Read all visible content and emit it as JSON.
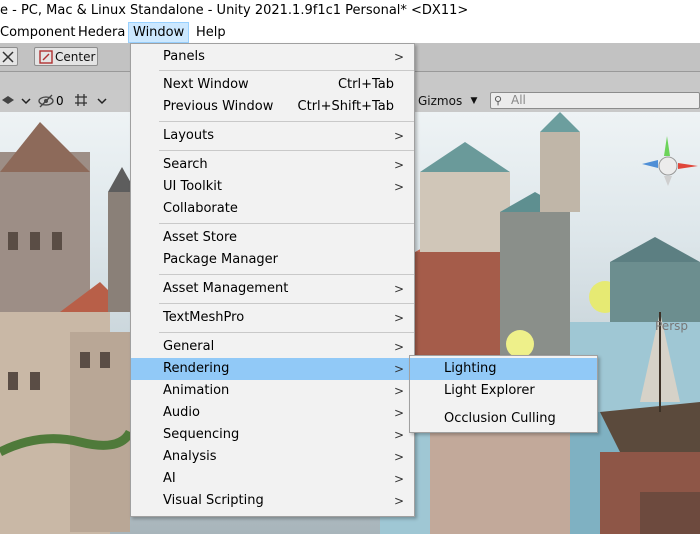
{
  "window": {
    "title": "e - PC, Mac & Linux Standalone - Unity 2021.1.9f1c1 Personal* <DX11>"
  },
  "menubar": {
    "items": [
      {
        "label": "Component"
      },
      {
        "label": "Hedera"
      },
      {
        "label": "Window"
      },
      {
        "label": "Help"
      }
    ]
  },
  "toolbar": {
    "pivot_label": "Center",
    "scene_count": "0"
  },
  "scene_toolbar": {
    "gizmos_label": "Gizmos",
    "search_placeholder": "All"
  },
  "scene": {
    "view_label": "Persp"
  },
  "window_menu": {
    "items": [
      {
        "label": "Panels",
        "has_submenu": true
      },
      {
        "label": "Next Window",
        "shortcut": "Ctrl+Tab"
      },
      {
        "label": "Previous Window",
        "shortcut": "Ctrl+Shift+Tab"
      },
      {
        "label": "Layouts",
        "has_submenu": true
      },
      {
        "label": "Search",
        "has_submenu": true
      },
      {
        "label": "UI Toolkit",
        "has_submenu": true
      },
      {
        "label": "Collaborate"
      },
      {
        "label": "Asset Store"
      },
      {
        "label": "Package Manager"
      },
      {
        "label": "Asset Management",
        "has_submenu": true
      },
      {
        "label": "TextMeshPro",
        "has_submenu": true
      },
      {
        "label": "General",
        "has_submenu": true
      },
      {
        "label": "Rendering",
        "has_submenu": true,
        "highlighted": true
      },
      {
        "label": "Animation",
        "has_submenu": true
      },
      {
        "label": "Audio",
        "has_submenu": true
      },
      {
        "label": "Sequencing",
        "has_submenu": true
      },
      {
        "label": "Analysis",
        "has_submenu": true
      },
      {
        "label": "AI",
        "has_submenu": true
      },
      {
        "label": "Visual Scripting",
        "has_submenu": true
      }
    ],
    "submenu_arrow": ">"
  },
  "rendering_submenu": {
    "items": [
      {
        "label": "Lighting",
        "highlighted": true
      },
      {
        "label": "Light Explorer"
      },
      {
        "label": "Occlusion Culling"
      }
    ]
  },
  "colors": {
    "highlight": "#91c9f7",
    "annotation_arrow": "#e8262a",
    "menu_bg": "#f2f2f2"
  }
}
